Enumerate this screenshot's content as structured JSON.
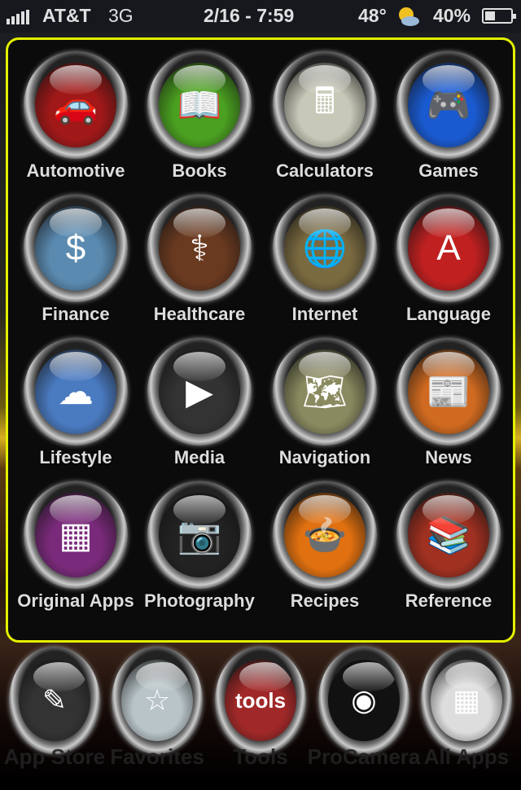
{
  "status": {
    "carrier": "AT&T",
    "network": "3G",
    "datetime": "2/16 - 7:59",
    "temperature": "48°",
    "weather_icon": "partly-cloudy-icon",
    "battery": "40%",
    "battery_level": 0.4,
    "signal_bars": 5
  },
  "folder": {
    "border_color": "#e4f000",
    "apps": [
      {
        "label": "Automotive",
        "icon": "car-icon",
        "color": "#a01818",
        "glyph": "🚗"
      },
      {
        "label": "Books",
        "icon": "book-icon",
        "color": "#4aa020",
        "glyph": "📖"
      },
      {
        "label": "Calculators",
        "icon": "calculator-icon",
        "color": "#c8c8b8",
        "glyph": "🖩"
      },
      {
        "label": "Games",
        "icon": "gamepad-icon",
        "color": "#1a5ad0",
        "glyph": "🎮"
      },
      {
        "label": "Finance",
        "icon": "finance-icon",
        "color": "#5a8ab0",
        "glyph": "$"
      },
      {
        "label": "Healthcare",
        "icon": "caduceus-icon",
        "color": "#6a3a20",
        "glyph": "⚕"
      },
      {
        "label": "Internet",
        "icon": "internet-icon",
        "color": "#7a6a40",
        "glyph": "🌐"
      },
      {
        "label": "Language",
        "icon": "language-icon",
        "color": "#c02020",
        "glyph": "A"
      },
      {
        "label": "Lifestyle",
        "icon": "lifestyle-icon",
        "color": "#4a7ac0",
        "glyph": "☁"
      },
      {
        "label": "Media",
        "icon": "media-icon",
        "color": "#333",
        "glyph": "▶"
      },
      {
        "label": "Navigation",
        "icon": "map-icon",
        "color": "#8a8a60",
        "glyph": "🗺"
      },
      {
        "label": "News",
        "icon": "rss-icon",
        "color": "#d06a20",
        "glyph": "📰"
      },
      {
        "label": "Original Apps",
        "icon": "app-pages-icon",
        "color": "#7a2a7a",
        "glyph": "▦"
      },
      {
        "label": "Photography",
        "icon": "camera-icon",
        "color": "#222",
        "glyph": "📷"
      },
      {
        "label": "Recipes",
        "icon": "recipes-icon",
        "color": "#e07010",
        "glyph": "🍲"
      },
      {
        "label": "Reference",
        "icon": "books-stack-icon",
        "color": "#a03020",
        "glyph": "📚"
      }
    ]
  },
  "dock": [
    {
      "label": "App Store",
      "icon": "app-store-icon",
      "color": "#333",
      "glyph": "✎"
    },
    {
      "label": "Favorites",
      "icon": "star-icon",
      "color": "#b8c4c8",
      "glyph": "☆"
    },
    {
      "label": "Tools",
      "icon": "tools-icon",
      "color": "#a02828",
      "glyph": "tools"
    },
    {
      "label": "ProCamera",
      "icon": "pro-camera-icon",
      "color": "#111",
      "glyph": "◉"
    },
    {
      "label": "All Apps",
      "icon": "all-apps-icon",
      "color": "#ddd",
      "glyph": "▦"
    }
  ]
}
